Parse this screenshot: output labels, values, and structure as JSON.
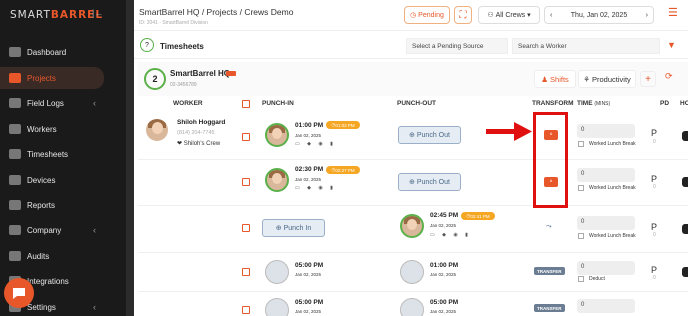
{
  "sidebar": {
    "logo_a": "SMART",
    "logo_b": "BARREL",
    "collapse": "|←",
    "items": [
      {
        "label": "Dashboard",
        "icon": "dashboard-icon"
      },
      {
        "label": "Projects",
        "icon": "folder-icon"
      },
      {
        "label": "Field Logs",
        "icon": "clipboard-icon"
      },
      {
        "label": "Workers",
        "icon": "users-icon"
      },
      {
        "label": "Timesheets",
        "icon": "clock-icon"
      },
      {
        "label": "Devices",
        "icon": "device-icon"
      },
      {
        "label": "Reports",
        "icon": "report-icon"
      },
      {
        "label": "Company",
        "icon": "building-icon"
      },
      {
        "label": "Audits",
        "icon": "audit-icon"
      },
      {
        "label": "Integrations",
        "icon": "plug-icon"
      },
      {
        "label": "Settings",
        "icon": "gear-icon"
      }
    ],
    "chevron": "‹",
    "accent": "#e8572a"
  },
  "header": {
    "breadcrumb": "SmartBarrel HQ  /  Projects  /  Crews Demo",
    "sub": "ID: 2041  ·  SmartBarrel Division",
    "pending": "Pending",
    "crews": "All Crews",
    "date": "Thu, Jan 02, 2025",
    "prev": "‹",
    "next": "›"
  },
  "toolbar": {
    "timesheets_count": "?",
    "timesheets_label": "Timesheets",
    "pending_source_placeholder": "Select a Pending Source",
    "search_worker_placeholder": "Search a Worker"
  },
  "group": {
    "count": "2",
    "title": "SmartBarrel HQ",
    "sub": "02-3456789",
    "shifts": "Shifts",
    "productivity": "Productivity",
    "add": "+"
  },
  "columns": {
    "worker": "WORKER",
    "punch_in": "PUNCH-IN",
    "punch_out": "PUNCH-OUT",
    "transform": "TRANSFORM",
    "time": "TIME",
    "time_unit": "(MINS)",
    "pd": "PD",
    "ho": "HO"
  },
  "worker": {
    "name": "Shiloh Hoggard",
    "phone": "(814) 204-7745",
    "crew": "❤ Shiloh's Crew"
  },
  "rows": [
    {
      "in_time": "01:00 PM",
      "in_badge": "01:02 PM",
      "in_date": "Jan 02, 2025",
      "out_btn": "Punch Out",
      "time": "0",
      "break": "Worked Lunch Break",
      "pd": "P",
      "pdz": "0"
    },
    {
      "in_time": "02:30 PM",
      "in_badge": "02:27 PM",
      "in_date": "Jan 02, 2025",
      "out_btn": "Punch Out",
      "time": "0",
      "break": "Worked Lunch Break",
      "pd": "P",
      "pdz": "0"
    },
    {
      "in_btn": "Punch In",
      "out_time": "02:45 PM",
      "out_badge": "02:41 PM",
      "out_date": "Jan 02, 2025",
      "time": "0",
      "break": "Worked Lunch Break",
      "pd": "P",
      "pdz": "0"
    },
    {
      "in_time": "05:00 PM",
      "in_date": "Jan 02, 2025",
      "out_time": "01:00 PM",
      "out_date": "Jan 02, 2025",
      "transfer": "TRANSFER",
      "time": "0",
      "break": "Deduct",
      "pd": "P",
      "pdz": "0"
    },
    {
      "in_time": "05:00 PM",
      "in_date": "Jan 02, 2025",
      "out_time": "05:00 PM",
      "out_date": "Jan 02, 2025",
      "transfer": "TRANSFER",
      "time": "0"
    }
  ],
  "icons": {
    "row_icons": "▭ ◆ ◉ ▮",
    "transform_icon": "ᴬ",
    "split_icon": "⤳"
  },
  "colors": {
    "accent": "#e8572a",
    "highlight": "#e01010",
    "badge": "#f5a623"
  }
}
